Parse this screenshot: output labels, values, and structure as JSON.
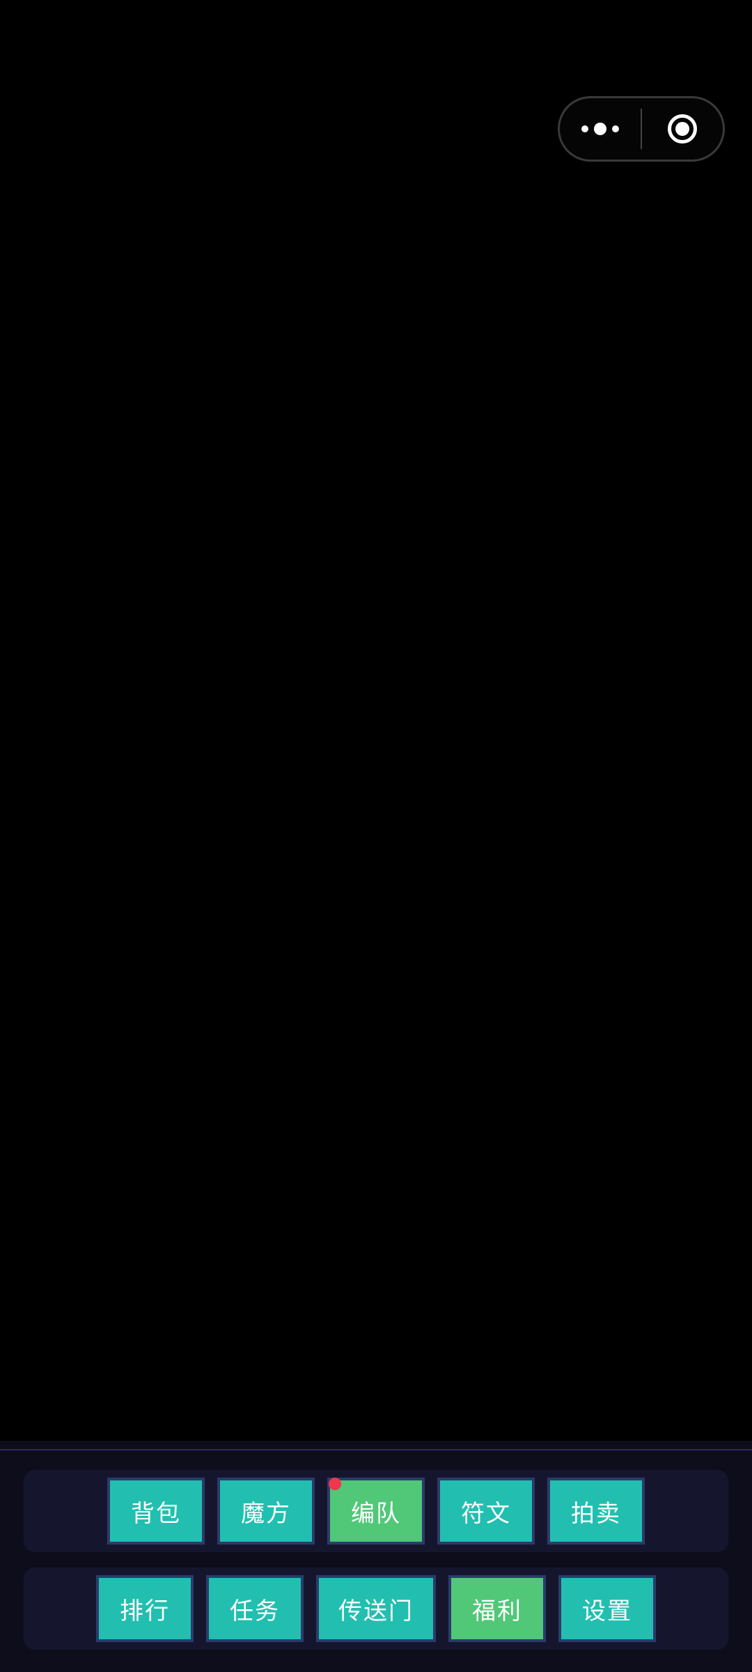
{
  "capsule": {
    "menu_icon": "more-dots-icon",
    "close_icon": "target-circle-icon"
  },
  "menu": {
    "row1": [
      {
        "label": "背包",
        "style": "teal"
      },
      {
        "label": "魔方",
        "style": "teal"
      },
      {
        "label": "编队",
        "style": "green",
        "notification": true
      },
      {
        "label": "符文",
        "style": "teal"
      },
      {
        "label": "拍卖",
        "style": "teal"
      }
    ],
    "row2": [
      {
        "label": "排行",
        "style": "teal"
      },
      {
        "label": "任务",
        "style": "teal"
      },
      {
        "label": "传送门",
        "style": "teal"
      },
      {
        "label": "福利",
        "style": "green"
      },
      {
        "label": "设置",
        "style": "teal"
      }
    ]
  },
  "colors": {
    "teal": "#22bfb0",
    "green": "#50c878",
    "badge": "#f0364d",
    "panel": "#15162e",
    "border": "#2c3b6b"
  }
}
